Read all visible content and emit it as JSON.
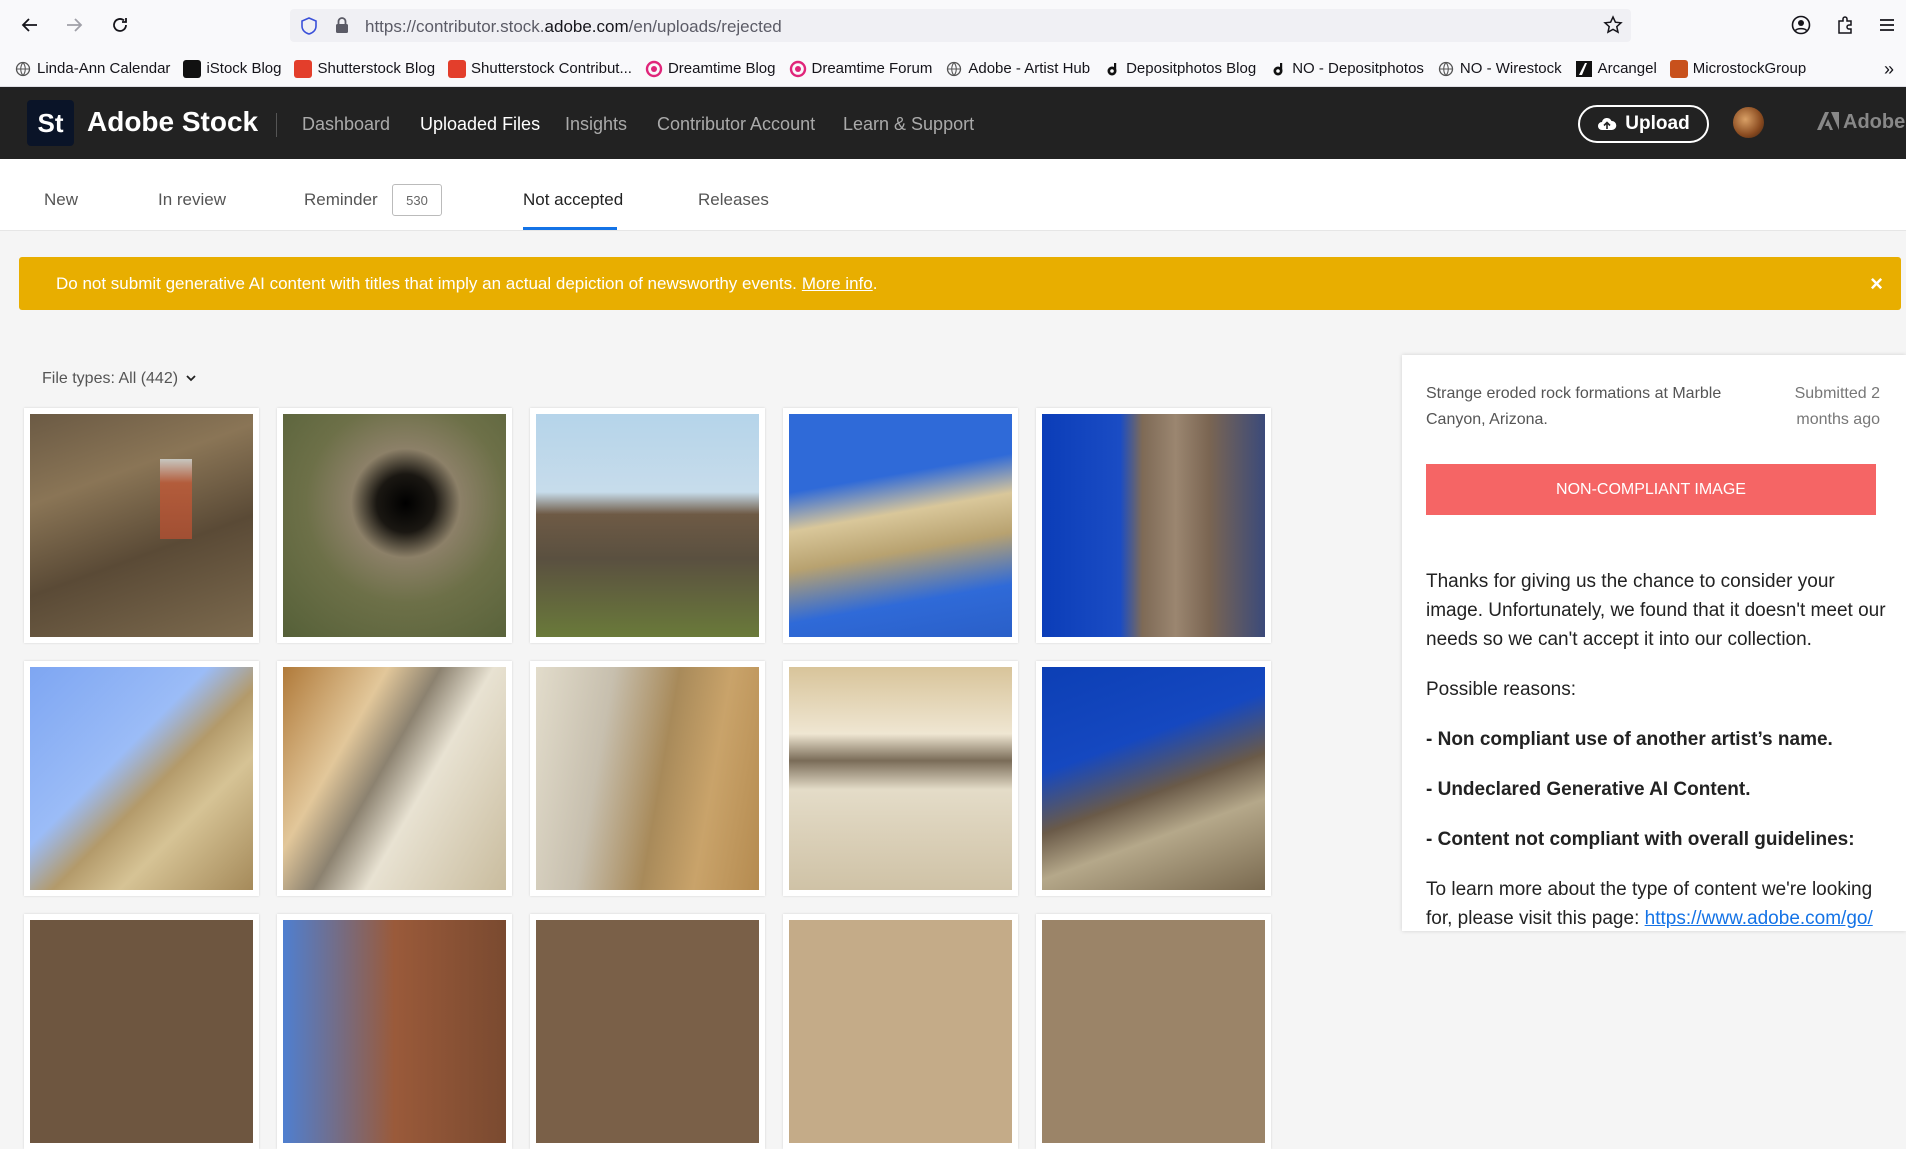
{
  "browser": {
    "url_prefix": "https://contributor.stock.",
    "url_domain": "adobe.com",
    "url_suffix": "/en/uploads/rejected"
  },
  "bookmarks": [
    {
      "label": "Linda-Ann Calendar",
      "icon": "globe-icon",
      "color": "#555555"
    },
    {
      "label": "iStock Blog",
      "icon": "istock-icon",
      "color": "#111111"
    },
    {
      "label": "Shutterstock Blog",
      "icon": "shutterstock-icon",
      "color": "#e33e2b"
    },
    {
      "label": "Shutterstock Contribut...",
      "icon": "shutterstock-icon",
      "color": "#e33e2b"
    },
    {
      "label": "Dreamtime Blog",
      "icon": "dreamstime-icon",
      "color": "#e0257a"
    },
    {
      "label": "Dreamtime Forum",
      "icon": "dreamstime-icon",
      "color": "#e0257a"
    },
    {
      "label": "Adobe - Artist Hub",
      "icon": "globe-icon",
      "color": "#555555"
    },
    {
      "label": "Depositphotos Blog",
      "icon": "depositphotos-icon",
      "color": "#111111"
    },
    {
      "label": "NO - Depositphotos",
      "icon": "depositphotos-icon",
      "color": "#111111"
    },
    {
      "label": "NO - Wirestock",
      "icon": "globe-icon",
      "color": "#555555"
    },
    {
      "label": "Arcangel",
      "icon": "arcangel-icon",
      "color": "#111111"
    },
    {
      "label": "MicrostockGroup",
      "icon": "microstockgroup-icon",
      "color": "#c8511c"
    }
  ],
  "header": {
    "logo_mark": "St",
    "logo_text": "Adobe Stock",
    "nav": [
      "Dashboard",
      "Uploaded Files",
      "Insights",
      "Contributor Account",
      "Learn & Support"
    ],
    "active_nav": "Uploaded Files",
    "upload_label": "Upload",
    "brand": "Adobe"
  },
  "tabs": {
    "items": [
      "New",
      "In review",
      "Reminder",
      "Not accepted",
      "Releases"
    ],
    "active": "Not accepted",
    "reminder_count": "530"
  },
  "alert": {
    "text": "Do not submit generative AI content with titles that imply an actual depiction of newsworthy events.",
    "link": "More info",
    "trailing": ".",
    "close": "×"
  },
  "filter": {
    "label": "File types: All (442)"
  },
  "panel": {
    "title": "Strange eroded rock formations at Marble Canyon, Arizona.",
    "submitted": "Submitted 2 months ago",
    "status": "NON-COMPLIANT IMAGE",
    "intro": "Thanks for giving us the chance to consider your image. Unfortunately, we found that it doesn't meet our needs so we can't accept it into our collection.",
    "reasons_heading": "Possible reasons:",
    "reasons": [
      "- Non compliant use of another artist’s name.",
      "- Undeclared Generative AI Content.",
      "- Content not compliant with overall guidelines:"
    ],
    "learn_more": "To learn more about the type of content we're looking for, please visit this page: ",
    "learn_more_link": "https://www.adobe.com/go/"
  },
  "colors": {
    "accent": "#1473e6",
    "alert": "#e8ae00",
    "status_badge": "#f56565",
    "header": "#222222"
  }
}
